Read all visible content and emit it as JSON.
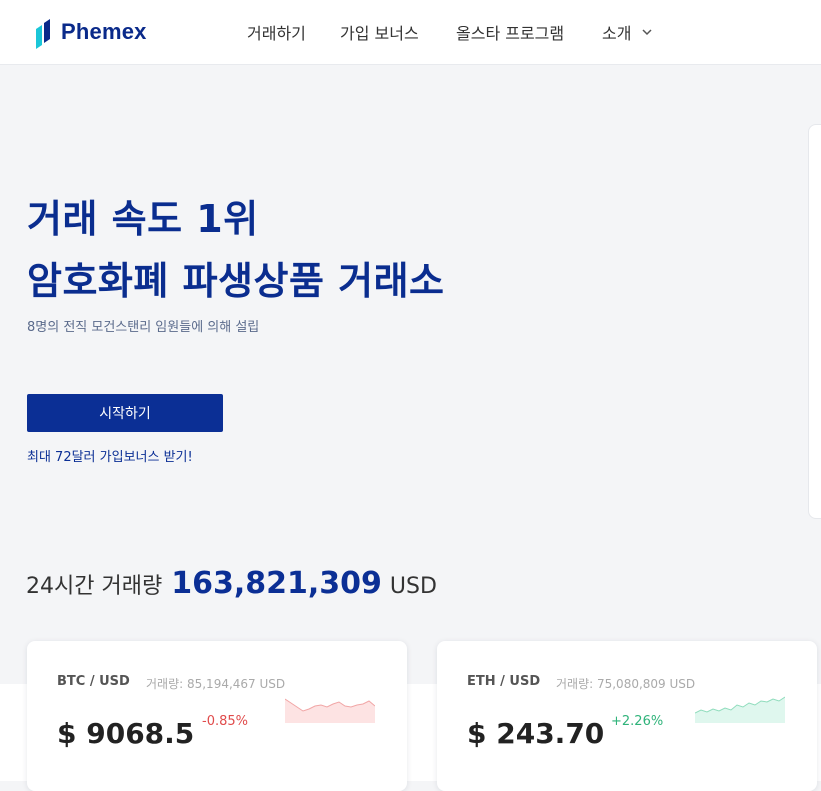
{
  "brand": {
    "name": "Phemex"
  },
  "nav": {
    "items": [
      {
        "label": "거래하기"
      },
      {
        "label": "가입 보너스"
      },
      {
        "label": "올스타 프로그램"
      },
      {
        "label": "소개"
      }
    ]
  },
  "hero": {
    "title_line1": "거래 속도 1위",
    "title_line2": "암호화폐 파생상품 거래소",
    "subtitle": "8명의 전직 모건스탠리 임원들에 의해 설립",
    "cta_label": "시작하기",
    "bonus_text": "최대 72달러 가입보너스 받기!"
  },
  "volume": {
    "label": "24시간 거래량",
    "value": "163,821,309",
    "unit": "USD"
  },
  "tickers": [
    {
      "pair": "BTC / USD",
      "volume_text": "거래량: 85,194,467 USD",
      "price": "$ 9068.5",
      "change": "-0.85%",
      "trend": "down",
      "color": "#e04b4b",
      "fill": "#fde3e3"
    },
    {
      "pair": "ETH / USD",
      "volume_text": "거래량: 75,080,809 USD",
      "price": "$ 243.70",
      "change": "+2.26%",
      "trend": "up",
      "color": "#2fb37a",
      "fill": "#dff7ee"
    }
  ],
  "colors": {
    "brand": "#0b2f95",
    "background": "#f4f5f7",
    "down": "#e04b4b",
    "up": "#2fb37a"
  }
}
